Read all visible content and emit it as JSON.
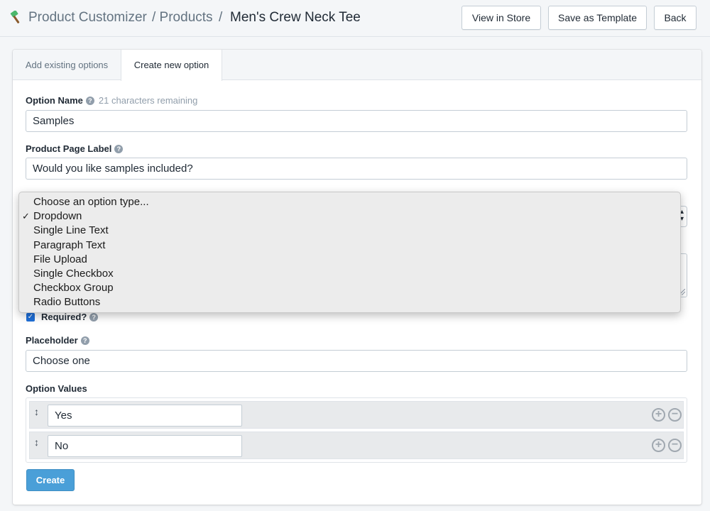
{
  "header": {
    "breadcrumb": [
      {
        "label": "Product Customizer"
      },
      {
        "label": "/ Products"
      },
      {
        "label": "/"
      },
      {
        "label": "Men's Crew Neck Tee"
      }
    ],
    "buttons": {
      "view_in_store": "View in Store",
      "save_as_template": "Save as Template",
      "back": "Back"
    }
  },
  "tabs": [
    {
      "label": "Add existing options",
      "active": false
    },
    {
      "label": "Create new option",
      "active": true
    }
  ],
  "form": {
    "option_name": {
      "label": "Option Name",
      "hint": "21 characters remaining",
      "value": "Samples"
    },
    "page_label": {
      "label": "Product Page Label",
      "value": "Would you like samples included?"
    },
    "required": {
      "label": "Required?",
      "checked": true
    },
    "placeholder": {
      "label": "Placeholder",
      "value": "Choose one"
    },
    "option_values": {
      "label": "Option Values",
      "rows": [
        {
          "value": "Yes"
        },
        {
          "value": "No"
        }
      ]
    },
    "create_label": "Create"
  },
  "option_type_dropdown": {
    "selected": "Dropdown",
    "check_mark": "✓",
    "options": [
      {
        "label": "Choose an option type..."
      },
      {
        "label": "Dropdown"
      },
      {
        "label": "Single Line Text"
      },
      {
        "label": "Paragraph Text"
      },
      {
        "label": "File Upload"
      },
      {
        "label": "Single Checkbox"
      },
      {
        "label": "Checkbox Group"
      },
      {
        "label": "Radio Buttons"
      }
    ]
  },
  "icons": {
    "help": "question-circle-icon",
    "grip": "drag-handle-icon",
    "add": "plus-circle-icon",
    "remove": "minus-circle-icon"
  },
  "colors": {
    "primary_button": "#4a9fd8",
    "checkbox": "#1f6fd8"
  }
}
